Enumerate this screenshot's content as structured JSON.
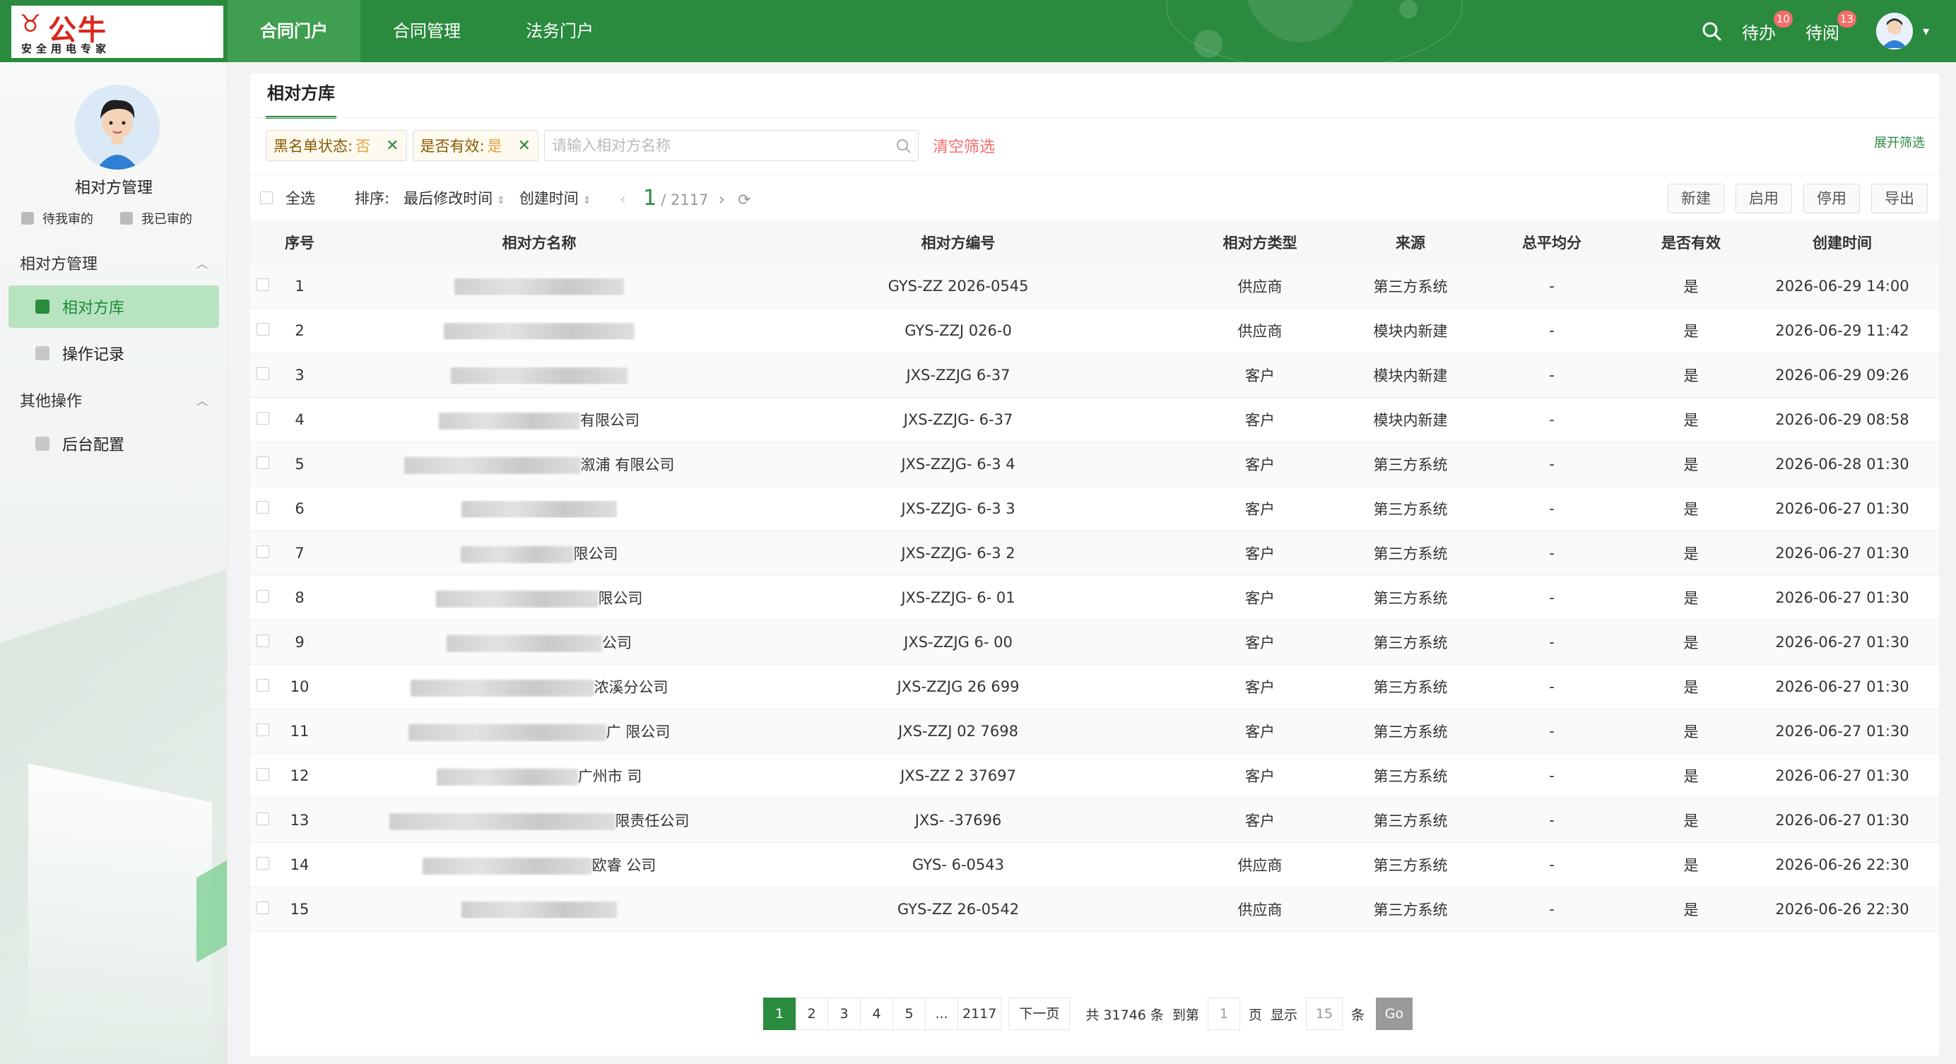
{
  "brand": {
    "name": "公牛",
    "slogan": "安全用电专家"
  },
  "topnav": [
    "合同门户",
    "合同管理",
    "法务门户"
  ],
  "topright": {
    "todo": "待办",
    "todo_count": "10",
    "toread": "待阅",
    "toread_count": "13"
  },
  "sidebar": {
    "title": "相对方管理",
    "mini": [
      "待我审的",
      "我已审的"
    ],
    "groups": [
      {
        "label": "相对方管理",
        "items": [
          "相对方库",
          "操作记录"
        ]
      },
      {
        "label": "其他操作",
        "items": [
          "后台配置"
        ]
      }
    ]
  },
  "page": {
    "tab": "相对方库",
    "filters": [
      {
        "key": "黑名单状态:",
        "value": "否"
      },
      {
        "key": "是否有效:",
        "value": "是"
      }
    ],
    "search_placeholder": "请输入相对方名称",
    "clear_filter": "清空筛选",
    "expand": "展开筛选"
  },
  "toolbar": {
    "select_all": "全选",
    "sort_label": "排序:",
    "sort1": "最后修改时间",
    "sort2": "创建时间",
    "current_page": "1",
    "total_pages": "/ 2117",
    "buttons": [
      "新建",
      "启用",
      "停用",
      "导出"
    ]
  },
  "table": {
    "headers": [
      "序号",
      "相对方名称",
      "相对方编号",
      "相对方类型",
      "来源",
      "总平均分",
      "是否有效",
      "创建时间"
    ],
    "rows": [
      {
        "no": "1",
        "name": "",
        "code": "GYS-ZZ  2026-0545",
        "type": "供应商",
        "src": "第三方系统",
        "score": "-",
        "valid": "是",
        "time": "2026-06-29 14:00"
      },
      {
        "no": "2",
        "name": "",
        "code": "GYS-ZZJ  026-0",
        "type": "供应商",
        "src": "模块内新建",
        "score": "-",
        "valid": "是",
        "time": "2026-06-29 11:42"
      },
      {
        "no": "3",
        "name": "",
        "code": "JXS-ZZJG  6-37",
        "type": "客户",
        "src": "模块内新建",
        "score": "-",
        "valid": "是",
        "time": "2026-06-29 09:26"
      },
      {
        "no": "4",
        "name": "有限公司",
        "code": "JXS-ZZJG-  6-37",
        "type": "客户",
        "src": "模块内新建",
        "score": "-",
        "valid": "是",
        "time": "2026-06-29 08:58"
      },
      {
        "no": "5",
        "name": "溆浦  有限公司",
        "code": "JXS-ZZJG-  6-3  4",
        "type": "客户",
        "src": "第三方系统",
        "score": "-",
        "valid": "是",
        "time": "2026-06-28 01:30"
      },
      {
        "no": "6",
        "name": "",
        "code": "JXS-ZZJG-  6-3  3",
        "type": "客户",
        "src": "第三方系统",
        "score": "-",
        "valid": "是",
        "time": "2026-06-27 01:30"
      },
      {
        "no": "7",
        "name": "限公司",
        "code": "JXS-ZZJG-  6-3  2",
        "type": "客户",
        "src": "第三方系统",
        "score": "-",
        "valid": "是",
        "time": "2026-06-27 01:30"
      },
      {
        "no": "8",
        "name": "限公司",
        "code": "JXS-ZZJG-  6-  01",
        "type": "客户",
        "src": "第三方系统",
        "score": "-",
        "valid": "是",
        "time": "2026-06-27 01:30"
      },
      {
        "no": "9",
        "name": "公司",
        "code": "JXS-ZZJG  6-  00",
        "type": "客户",
        "src": "第三方系统",
        "score": "-",
        "valid": "是",
        "time": "2026-06-27 01:30"
      },
      {
        "no": "10",
        "name": "浓溪分公司",
        "code": "JXS-ZZJG  26  699",
        "type": "客户",
        "src": "第三方系统",
        "score": "-",
        "valid": "是",
        "time": "2026-06-27 01:30"
      },
      {
        "no": "11",
        "name": "广  限公司",
        "code": "JXS-ZZJ  02  7698",
        "type": "客户",
        "src": "第三方系统",
        "score": "-",
        "valid": "是",
        "time": "2026-06-27 01:30"
      },
      {
        "no": "12",
        "name": "广州市  司",
        "code": "JXS-ZZ  2  37697",
        "type": "客户",
        "src": "第三方系统",
        "score": "-",
        "valid": "是",
        "time": "2026-06-27 01:30"
      },
      {
        "no": "13",
        "name": "限责任公司",
        "code": "JXS-  -37696",
        "type": "客户",
        "src": "第三方系统",
        "score": "-",
        "valid": "是",
        "time": "2026-06-27 01:30"
      },
      {
        "no": "14",
        "name": "欧睿  公司",
        "code": "GYS-  6-0543",
        "type": "供应商",
        "src": "第三方系统",
        "score": "-",
        "valid": "是",
        "time": "2026-06-26 22:30"
      },
      {
        "no": "15",
        "name": "",
        "code": "GYS-ZZ  26-0542",
        "type": "供应商",
        "src": "第三方系统",
        "score": "-",
        "valid": "是",
        "time": "2026-06-26 22:30"
      }
    ]
  },
  "pagination": {
    "pages": [
      "1",
      "2",
      "3",
      "4",
      "5",
      "...",
      "2117"
    ],
    "next": "下一页",
    "total": "共 31746 条",
    "goto": "到第",
    "goto_value": "1",
    "page_unit": "页",
    "show": "显示",
    "show_value": "15",
    "item_unit": "条",
    "go": "Go"
  },
  "colors": {
    "brand_green": "#2a8a3e",
    "badge_red": "#f56c6c",
    "logo_red": "#d9261c"
  }
}
